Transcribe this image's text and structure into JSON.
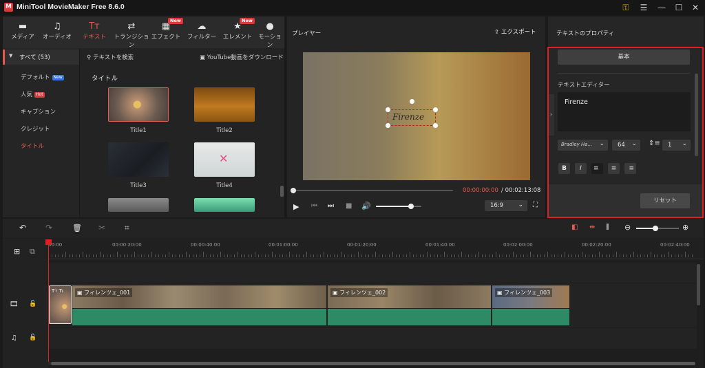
{
  "app": {
    "logo": "M",
    "title": "MiniTool MovieMaker Free 8.6.0"
  },
  "window_controls": [
    "key-icon",
    "menu-icon",
    "minimize-icon",
    "maximize-icon",
    "close-icon"
  ],
  "toolbar": {
    "items": [
      {
        "label": "メディア",
        "icon": "folder-icon"
      },
      {
        "label": "オーディオ",
        "icon": "music-note-icon"
      },
      {
        "label": "テキスト",
        "icon": "text-icon",
        "active": true
      },
      {
        "label": "トランジション",
        "icon": "transition-icon"
      },
      {
        "label": "エフェクト",
        "icon": "effect-icon",
        "new": "New"
      },
      {
        "label": "フィルター",
        "icon": "filter-icon"
      },
      {
        "label": "エレメント",
        "icon": "element-icon",
        "new": "New"
      },
      {
        "label": "モーション",
        "icon": "motion-icon"
      }
    ]
  },
  "categories": {
    "all": "すべて (53)",
    "items": [
      {
        "label": "デフォルト",
        "badge": "New"
      },
      {
        "label": "人気",
        "badge": "Hot"
      },
      {
        "label": "キャプション"
      },
      {
        "label": "クレジット"
      },
      {
        "label": "タイトル",
        "active": true
      }
    ]
  },
  "library": {
    "search": "テキストを検索",
    "download": "YouTube動画をダウンロード",
    "section": "タイトル",
    "thumbs": [
      "Title1",
      "Title2",
      "Title3",
      "Title4"
    ]
  },
  "player": {
    "title": "プレイヤー",
    "export": "エクスポート",
    "overlay_text": "Firenze",
    "time_current": "00:00:00:00",
    "time_total": "/ 00:02:13:08",
    "aspect": "16:9",
    "progress": 0.0,
    "volume": 0.78
  },
  "properties": {
    "title": "テキストのプロパティ",
    "tab_basic": "基本",
    "editor_label": "テキストエディター",
    "editor_text": "Firenze",
    "font": "Bradley Ha...",
    "size": "64",
    "line_spacing": "1",
    "format_buttons": [
      "B",
      "I",
      "≡",
      "≡",
      "≡"
    ],
    "reset": "リセット"
  },
  "timeline": {
    "ruler": [
      "00:00",
      "00:00:20:00",
      "00:00:40:00",
      "00:01:00:00",
      "00:01:20:00",
      "00:01:40:00",
      "00:02:00:00",
      "00:02:20:00",
      "00:02:40:00"
    ],
    "text_clip": "Tт Tı",
    "clips": [
      "フィレンツェ_001",
      "フィレンツェ_002",
      "フィレンツェ_003"
    ],
    "zoom": 0.45
  },
  "colors": {
    "accent": "#e55a4e",
    "highlight_border": "#e02020",
    "audio_track": "#2d8a64"
  }
}
